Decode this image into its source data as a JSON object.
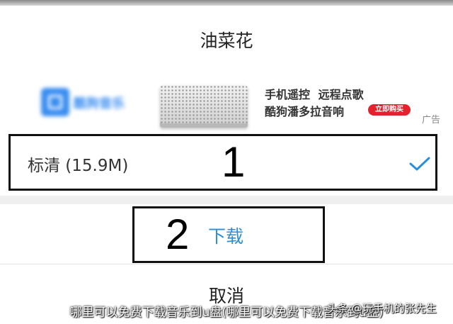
{
  "dialog": {
    "title": "油菜花",
    "cancel_label": "取消"
  },
  "ad": {
    "brand_text": "酷狗音乐",
    "line1": "手机遥控 远程点歌",
    "line2": "酷狗潘多拉音响",
    "button_label": "立即购买",
    "tag": "广告"
  },
  "quality_option": {
    "label": "标清 (15.9M)",
    "annotation_number": "1",
    "selected": true
  },
  "download": {
    "annotation_number": "2",
    "label": "下载"
  },
  "overlay": {
    "caption": "哪里可以免费下载音乐到u盘(哪里可以免费下载音乐到u盘)",
    "watermark": "头条 @玩手机的张先生"
  },
  "colors": {
    "accent_blue": "#2b8fd8",
    "ad_red": "#e5212d"
  }
}
